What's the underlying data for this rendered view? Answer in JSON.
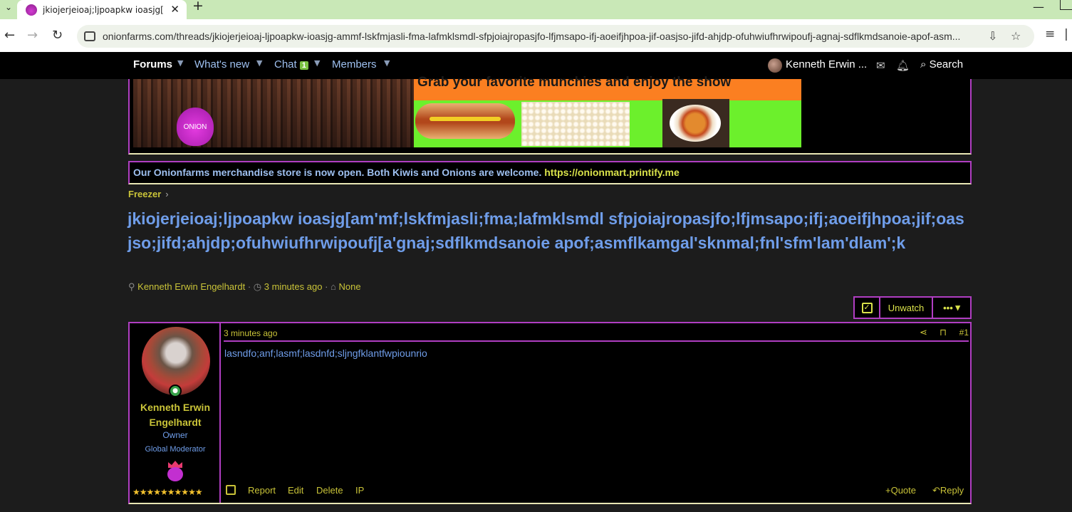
{
  "browser": {
    "tab_title": "jkiojerjeioaj;ljpoapkw ioasjg[am'",
    "new_tab": "+",
    "close_tab": "✕",
    "url": "onionfarms.com/threads/jkiojerjeioaj-ljpoapkw-ioasjg-ammf-lskfmjasli-fma-lafmklsmdl-sfpjoiajropasjfo-lfjmsapo-ifj-aoeifjhpoa-jif-oasjso-jifd-ahjdp-ofuhwiufhrwipoufj-agnaj-sdflkmdsanoie-apof-asm..."
  },
  "nav": {
    "forums": "Forums",
    "whats_new": "What's new",
    "chat": "Chat",
    "chat_badge": "1",
    "members": "Members",
    "user": "Kenneth Erwin ...",
    "search": "Search"
  },
  "banner": {
    "title": "Grab your favorite munchies and enjoy the show",
    "logo_text": "ONION"
  },
  "notice": {
    "text": "Our Onionfarms merchandise store is now open. Both Kiwis and Onions are welcome.",
    "link": "https://onionmart.printify.me"
  },
  "breadcrumb": {
    "item": "Freezer",
    "sep": "›"
  },
  "thread": {
    "title": "jkiojerjeioaj;ljpoapkw ioasjg[am'mf;lskfmjasli;fma;lafmklsmdl sfpjoiajropasjfo;lfjmsapo;ifj;aoeifjhpoa;jif;oasjso;jifd;ahjdp;ofuhwiufhrwipoufj[a'gnaj;sdflkmdsanoie apof;asmflkamgal'sknmal;fnl'sfm'lam'dlam';k",
    "author": "Kenneth Erwin Engelhardt",
    "time": "3 minutes ago",
    "tags": "None",
    "unwatch": "Unwatch",
    "more": "•••"
  },
  "post": {
    "time": "3 minutes ago",
    "number": "#1",
    "body": "lasndfo;anf;lasmf;lasdnfd;sljngfklantfwpiounrio",
    "user_name_line1": "Kenneth Erwin",
    "user_name_line2": "Engelhardt",
    "user_title": "Owner",
    "user_banner": "Global Moderator",
    "stars": "★★★★★★★★★★",
    "actions": {
      "report": "Report",
      "edit": "Edit",
      "delete": "Delete",
      "ip": "IP",
      "quote": "Quote",
      "reply": "Reply"
    }
  }
}
